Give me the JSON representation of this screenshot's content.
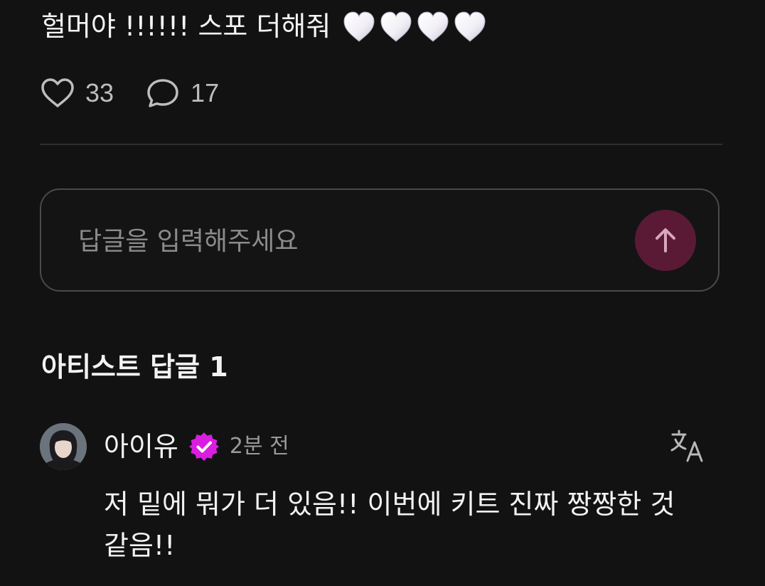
{
  "post": {
    "text": "헐머야 !!!!!! 스포 더해줘",
    "emoji_count": 4,
    "likes_count": "33",
    "comments_count": "17"
  },
  "reply": {
    "placeholder": "답글을 입력해주세요"
  },
  "artist_replies": {
    "section_title": "아티스트 답글 1",
    "comments": [
      {
        "author": "아이유",
        "timestamp": "2분 전",
        "text": "저 밑에 뭐가 더 있음!! 이번에 키트 진짜 짱짱한 것 같음!!"
      }
    ]
  },
  "colors": {
    "background": "#121212",
    "send_button": "#5a1a35",
    "verified_badge": "#d91ee0",
    "muted_text": "#9a9a9a"
  },
  "icons": {
    "emoji": "white-heart-icon",
    "like": "heart-outline-icon",
    "comment": "speech-bubble-icon",
    "send": "arrow-up-icon",
    "badge": "verified-badge-icon",
    "translate": "translate-icon"
  }
}
